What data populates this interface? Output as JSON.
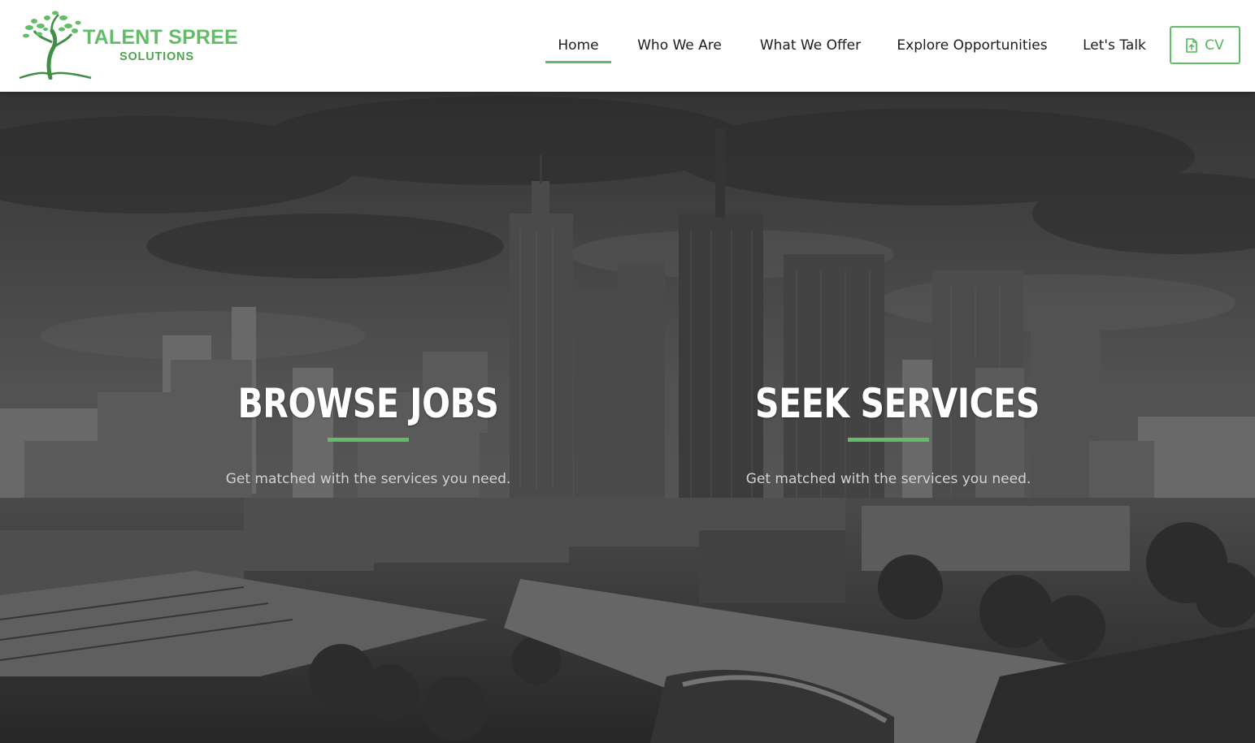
{
  "brand": {
    "name": "TALENT SPREE",
    "tagline": "SOLUTIONS",
    "logo_icon": "tree-logo-icon",
    "primary_color": "#63bd68"
  },
  "nav": {
    "items": [
      {
        "label": "Home",
        "active": true
      },
      {
        "label": "Who We Are",
        "active": false
      },
      {
        "label": "What We Offer",
        "active": false
      },
      {
        "label": "Explore Opportunities",
        "active": false
      },
      {
        "label": "Let's Talk",
        "active": false
      }
    ]
  },
  "cv_button": {
    "label": "CV",
    "icon": "file-upload-icon"
  },
  "hero": {
    "background": "grayscale-city-skyline",
    "cards": [
      {
        "title": "BROWSE JOBS",
        "text": "Get matched with the services you need."
      },
      {
        "title": "SEEK SERVICES",
        "text": "Get matched with the services you need."
      }
    ]
  }
}
